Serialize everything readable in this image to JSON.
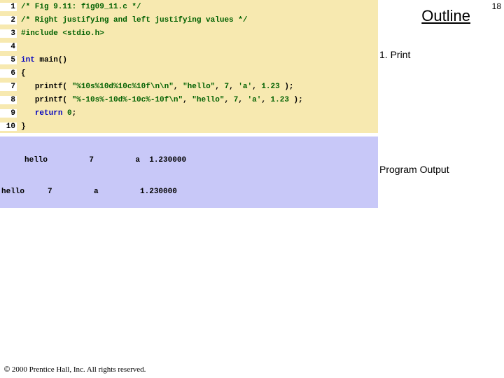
{
  "page_number": "18",
  "outline": {
    "title": "Outline",
    "annotations": [
      "1. Print",
      "Program Output"
    ]
  },
  "code": {
    "lines": [
      {
        "n": "1",
        "pre": "",
        "tokens": [
          {
            "c": "tok-comment",
            "t": "/* Fig 9.11: fig09_11.c */"
          }
        ]
      },
      {
        "n": "2",
        "pre": "",
        "tokens": [
          {
            "c": "tok-comment",
            "t": "/* Right justifying and left justifying values */"
          }
        ]
      },
      {
        "n": "3",
        "pre": "",
        "tokens": [
          {
            "c": "tok-preproc",
            "t": "#include <stdio.h>"
          }
        ]
      },
      {
        "n": "4",
        "pre": "",
        "tokens": []
      },
      {
        "n": "5",
        "pre": "",
        "tokens": [
          {
            "c": "tok-key",
            "t": "int"
          },
          {
            "c": "",
            "t": " main()"
          }
        ]
      },
      {
        "n": "6",
        "pre": "",
        "tokens": [
          {
            "c": "",
            "t": "{"
          }
        ]
      },
      {
        "n": "7",
        "pre": "   ",
        "tokens": [
          {
            "c": "",
            "t": "printf( "
          },
          {
            "c": "tok-str",
            "t": "\"%10s%10d%10c%10f\\n\\n\""
          },
          {
            "c": "",
            "t": ", "
          },
          {
            "c": "tok-str",
            "t": "\"hello\""
          },
          {
            "c": "",
            "t": ", "
          },
          {
            "c": "tok-num",
            "t": "7"
          },
          {
            "c": "",
            "t": ", "
          },
          {
            "c": "tok-char",
            "t": "'a'"
          },
          {
            "c": "",
            "t": ", "
          },
          {
            "c": "tok-num",
            "t": "1.23"
          },
          {
            "c": "",
            "t": " );"
          }
        ]
      },
      {
        "n": "8",
        "pre": "   ",
        "tokens": [
          {
            "c": "",
            "t": "printf( "
          },
          {
            "c": "tok-str",
            "t": "\"%-10s%-10d%-10c%-10f\\n\""
          },
          {
            "c": "",
            "t": ", "
          },
          {
            "c": "tok-str",
            "t": "\"hello\""
          },
          {
            "c": "",
            "t": ", "
          },
          {
            "c": "tok-num",
            "t": "7"
          },
          {
            "c": "",
            "t": ", "
          },
          {
            "c": "tok-char",
            "t": "'a'"
          },
          {
            "c": "",
            "t": ", "
          },
          {
            "c": "tok-num",
            "t": "1.23"
          },
          {
            "c": "",
            "t": " );"
          }
        ]
      },
      {
        "n": "9",
        "pre": "   ",
        "tokens": [
          {
            "c": "tok-key",
            "t": "return"
          },
          {
            "c": "",
            "t": " "
          },
          {
            "c": "tok-num",
            "t": "0"
          },
          {
            "c": "",
            "t": ";"
          }
        ]
      },
      {
        "n": "10",
        "pre": "",
        "tokens": [
          {
            "c": "",
            "t": "}"
          }
        ]
      }
    ]
  },
  "output": {
    "line1": "     hello         7         a  1.230000",
    "line2": "hello     7         a         1.230000"
  },
  "footer": {
    "copyright_symbol": "©",
    "text": " 2000 Prentice Hall, Inc. All rights reserved."
  }
}
